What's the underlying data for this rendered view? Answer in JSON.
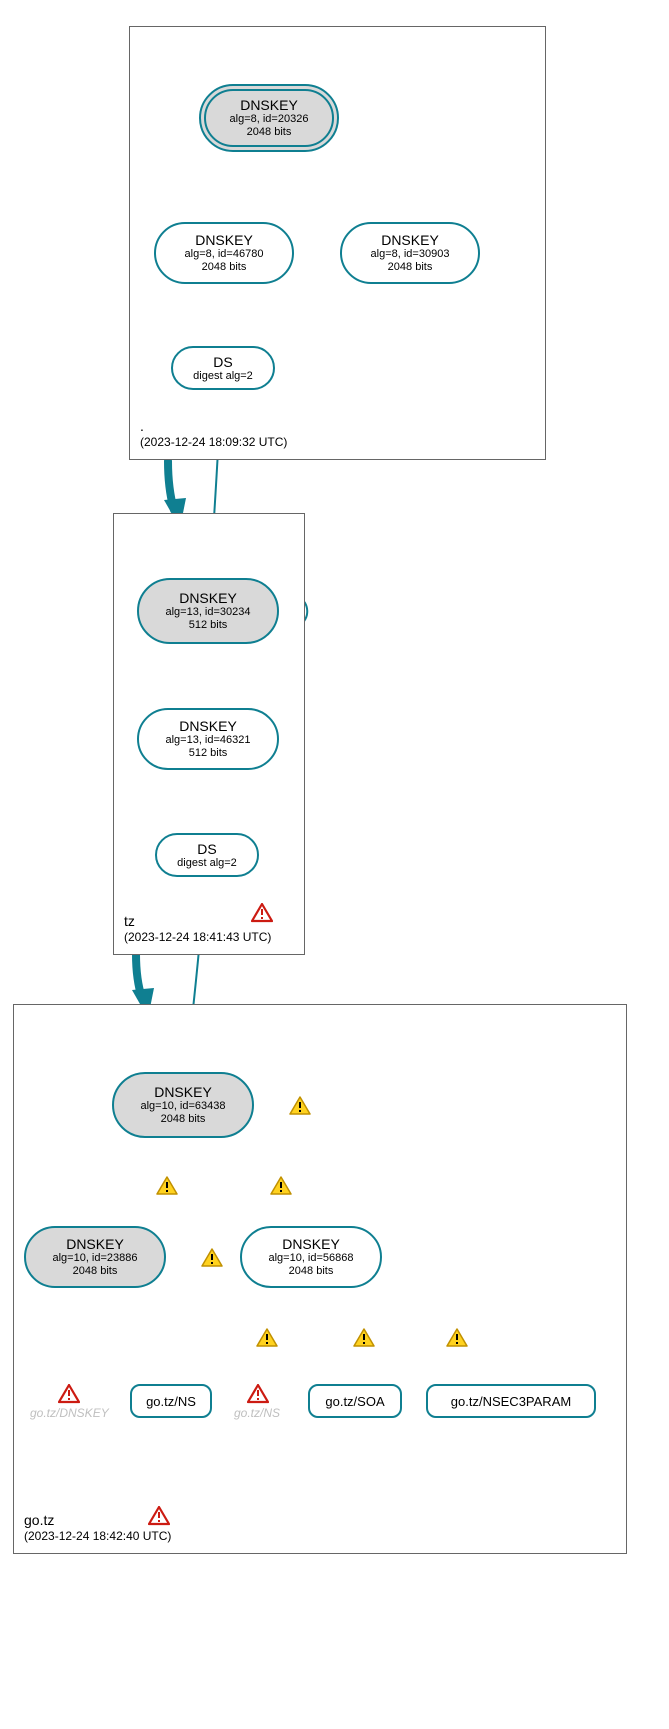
{
  "colors": {
    "stroke": "#0f7f91",
    "node_fill_sep": "#d9d9d9",
    "node_fill": "#ffffff",
    "warn_fill": "#ffd21f",
    "warn_stroke": "#c09000",
    "err_fill": "#ffffff",
    "err_stroke": "#cc1b12"
  },
  "zones": {
    "root": {
      "name": ".",
      "timestamp": "(2023-12-24 18:09:32 UTC)"
    },
    "tz": {
      "name": "tz",
      "timestamp": "(2023-12-24 18:41:43 UTC)"
    },
    "gotz": {
      "name": "go.tz",
      "timestamp": "(2023-12-24 18:42:40 UTC)"
    }
  },
  "nodes": {
    "root_ksk": {
      "title": "DNSKEY",
      "l2": "alg=8, id=20326",
      "l3": "2048 bits"
    },
    "root_zsk1": {
      "title": "DNSKEY",
      "l2": "alg=8, id=46780",
      "l3": "2048 bits"
    },
    "root_zsk2": {
      "title": "DNSKEY",
      "l2": "alg=8, id=30903",
      "l3": "2048 bits"
    },
    "root_ds": {
      "title": "DS",
      "l2": "digest alg=2"
    },
    "tz_ksk": {
      "title": "DNSKEY",
      "l2": "alg=13, id=30234",
      "l3": "512 bits"
    },
    "tz_zsk": {
      "title": "DNSKEY",
      "l2": "alg=13, id=46321",
      "l3": "512 bits"
    },
    "tz_ds": {
      "title": "DS",
      "l2": "digest alg=2"
    },
    "gotz_ksk": {
      "title": "DNSKEY",
      "l2": "alg=10, id=63438",
      "l3": "2048 bits"
    },
    "gotz_k2": {
      "title": "DNSKEY",
      "l2": "alg=10, id=23886",
      "l3": "2048 bits"
    },
    "gotz_zsk": {
      "title": "DNSKEY",
      "l2": "alg=10, id=56868",
      "l3": "2048 bits"
    }
  },
  "rr": {
    "ns": "go.tz/NS",
    "soa": "go.tz/SOA",
    "nsec3": "go.tz/NSEC3PARAM"
  },
  "ghosts": {
    "dnskey": "go.tz/DNSKEY",
    "ns": "go.tz/NS"
  }
}
